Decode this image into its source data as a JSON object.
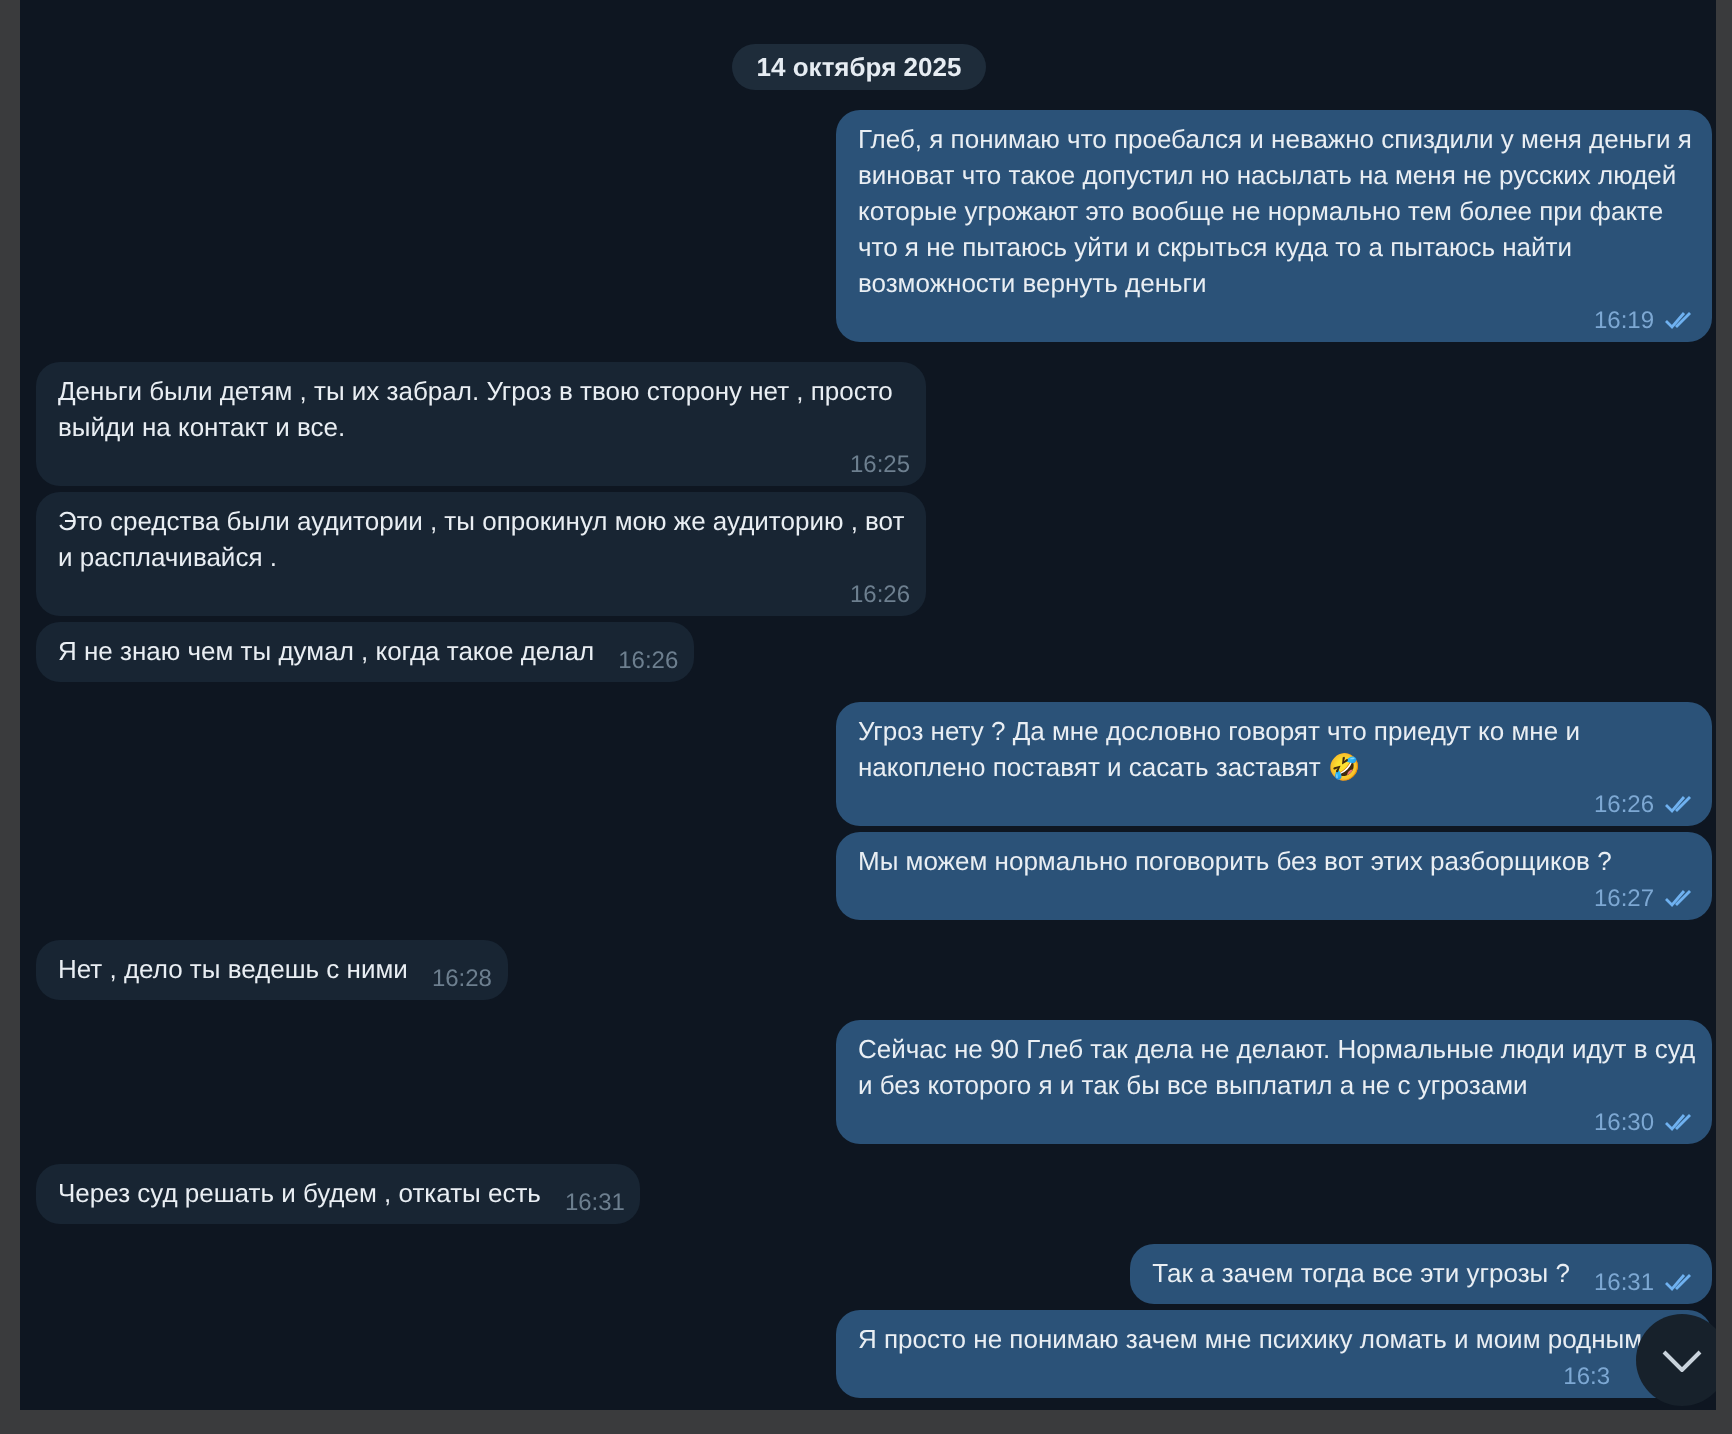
{
  "date_badge": "14 октября 2025",
  "messages": [
    {
      "kind": "outgoing",
      "text": "Глеб, я понимаю что проебался и неважно спиздили у меня деньги  я виноват что такое допустил но насылать на меня не русских людей которые угрожают это вообще не нормально тем более при факте что я не пытаюсь уйти и скрыться куда то а пытаюсь найти возможности вернуть деньги",
      "time": "16:19",
      "read": true
    },
    {
      "kind": "incoming",
      "text": "Деньги были детям , ты их забрал. Угроз в твою сторону нет , просто выйди на контакт и все.",
      "time": "16:25"
    },
    {
      "kind": "incoming",
      "text": "Это средства были аудитории , ты опрокинул мою же аудиторию , вот и расплачивайся .",
      "time": "16:26"
    },
    {
      "kind": "incoming",
      "text": "Я не знаю чем ты думал , когда такое делал",
      "time": "16:26"
    },
    {
      "kind": "outgoing",
      "text": "Угроз нету ? Да мне дословно говорят что приедут ко мне и накоплено поставят и сасать заставят 🤣",
      "time": "16:26",
      "read": true
    },
    {
      "kind": "outgoing",
      "text": "Мы можем нормально поговорить без вот этих разборщиков ?",
      "time": "16:27",
      "read": true
    },
    {
      "kind": "incoming",
      "text": "Нет , дело ты ведешь с ними",
      "time": "16:28"
    },
    {
      "kind": "outgoing",
      "text": "Сейчас не 90 Глеб так дела не делают. Нормальные люди идут в суд и без которого я и так бы все выплатил а не с угрозами",
      "time": "16:30",
      "read": true
    },
    {
      "kind": "incoming",
      "text": "Через суд решать и будем , откаты есть",
      "time": "16:31"
    },
    {
      "kind": "outgoing",
      "text": "Так а зачем тогда все эти угрозы ?",
      "time": "16:31",
      "read": true
    },
    {
      "kind": "outgoing",
      "text": "Я просто не понимаю зачем мне психику ломать и моим родным",
      "time": "16:3"
    }
  ]
}
